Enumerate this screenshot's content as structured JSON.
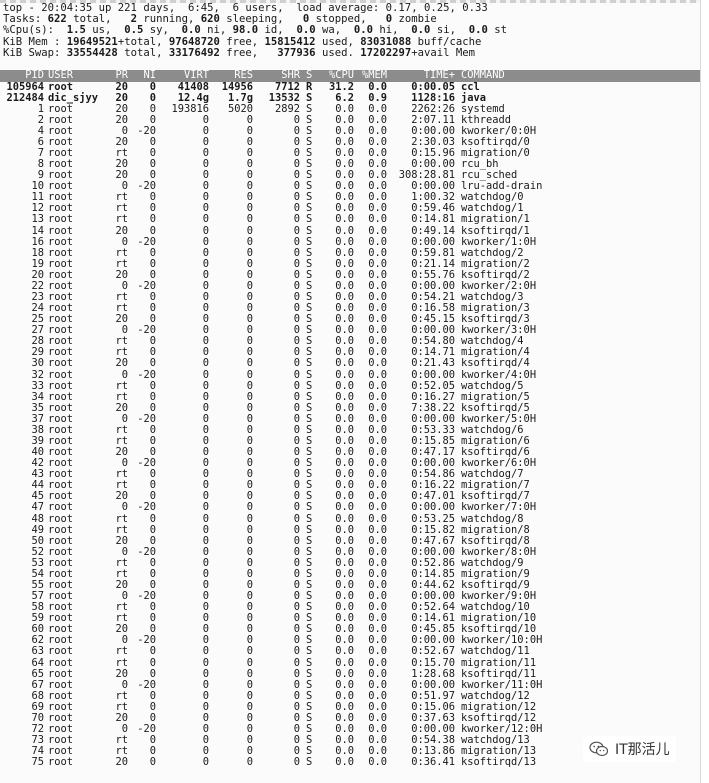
{
  "summary": {
    "line1": "top - 20:04:35 up 221 days,  6:45,  6 users,  load average: 0.17, 0.25, 0.33",
    "tasks_label": "Tasks:",
    "tasks": [
      {
        "value": "622",
        "label": " total,   "
      },
      {
        "value": "2",
        "label": " running, "
      },
      {
        "value": "620",
        "label": " sleeping,   "
      },
      {
        "value": "0",
        "label": " stopped,   "
      },
      {
        "value": "0",
        "label": " zombie"
      }
    ],
    "cpu_label": "%Cpu(s):",
    "cpu": [
      {
        "value": "  1.5",
        "label": " us,  "
      },
      {
        "value": "0.5",
        "label": " sy,  "
      },
      {
        "value": "0.0",
        "label": " ni, "
      },
      {
        "value": "98.0",
        "label": " id,  "
      },
      {
        "value": "0.0",
        "label": " wa,  "
      },
      {
        "value": "0.0",
        "label": " hi,  "
      },
      {
        "value": "0.0",
        "label": " si,  "
      },
      {
        "value": "0.0",
        "label": " st"
      }
    ],
    "mem_label": "KiB Mem :",
    "mem": [
      {
        "value": " 19649521",
        "label": "+total, "
      },
      {
        "value": "97648720",
        "label": " free, "
      },
      {
        "value": "15815412",
        "label": " used, "
      },
      {
        "value": "83031088",
        "label": " buff/cache"
      }
    ],
    "swap_label": "KiB Swap:",
    "swap": [
      {
        "value": " 33554428",
        "label": " total, "
      },
      {
        "value": "33176492",
        "label": " free,   "
      },
      {
        "value": "377936",
        "label": " used. "
      },
      {
        "value": "17202297",
        "label": "+avail Mem"
      }
    ]
  },
  "table": {
    "columns": [
      "PID",
      "USER",
      "PR",
      "NI",
      "VIRT",
      "RES",
      "SHR",
      "S",
      "%CPU",
      "%MEM",
      "TIME+",
      "COMMAND"
    ],
    "rows": [
      [
        "105964",
        "root",
        "20",
        "0",
        "41408",
        "14956",
        "7712",
        "R",
        "31.2",
        "0.0",
        "0:00.05",
        "ccl"
      ],
      [
        "212484",
        "dic_sjyy",
        "20",
        "0",
        "12.4g",
        "1.7g",
        "13532",
        "S",
        "6.2",
        "0.9",
        "1128:16",
        "java"
      ],
      [
        "1",
        "root",
        "20",
        "0",
        "193816",
        "5020",
        "2892",
        "S",
        "0.0",
        "0.0",
        "2262:26",
        "systemd"
      ],
      [
        "2",
        "root",
        "20",
        "0",
        "0",
        "0",
        "0",
        "S",
        "0.0",
        "0.0",
        "2:07.11",
        "kthreadd"
      ],
      [
        "4",
        "root",
        "0",
        "-20",
        "0",
        "0",
        "0",
        "S",
        "0.0",
        "0.0",
        "0:00.00",
        "kworker/0:0H"
      ],
      [
        "6",
        "root",
        "20",
        "0",
        "0",
        "0",
        "0",
        "S",
        "0.0",
        "0.0",
        "2:30.03",
        "ksoftirqd/0"
      ],
      [
        "7",
        "root",
        "rt",
        "0",
        "0",
        "0",
        "0",
        "S",
        "0.0",
        "0.0",
        "0:15.96",
        "migration/0"
      ],
      [
        "8",
        "root",
        "20",
        "0",
        "0",
        "0",
        "0",
        "S",
        "0.0",
        "0.0",
        "0:00.00",
        "rcu_bh"
      ],
      [
        "9",
        "root",
        "20",
        "0",
        "0",
        "0",
        "0",
        "S",
        "0.0",
        "0.0",
        "308:28.81",
        "rcu_sched"
      ],
      [
        "10",
        "root",
        "0",
        "-20",
        "0",
        "0",
        "0",
        "S",
        "0.0",
        "0.0",
        "0:00.00",
        "lru-add-drain"
      ],
      [
        "11",
        "root",
        "rt",
        "0",
        "0",
        "0",
        "0",
        "S",
        "0.0",
        "0.0",
        "1:00.32",
        "watchdog/0"
      ],
      [
        "12",
        "root",
        "rt",
        "0",
        "0",
        "0",
        "0",
        "S",
        "0.0",
        "0.0",
        "0:59.46",
        "watchdog/1"
      ],
      [
        "13",
        "root",
        "rt",
        "0",
        "0",
        "0",
        "0",
        "S",
        "0.0",
        "0.0",
        "0:14.81",
        "migration/1"
      ],
      [
        "14",
        "root",
        "20",
        "0",
        "0",
        "0",
        "0",
        "S",
        "0.0",
        "0.0",
        "0:49.14",
        "ksoftirqd/1"
      ],
      [
        "16",
        "root",
        "0",
        "-20",
        "0",
        "0",
        "0",
        "S",
        "0.0",
        "0.0",
        "0:00.00",
        "kworker/1:0H"
      ],
      [
        "18",
        "root",
        "rt",
        "0",
        "0",
        "0",
        "0",
        "S",
        "0.0",
        "0.0",
        "0:59.81",
        "watchdog/2"
      ],
      [
        "19",
        "root",
        "rt",
        "0",
        "0",
        "0",
        "0",
        "S",
        "0.0",
        "0.0",
        "0:21.14",
        "migration/2"
      ],
      [
        "20",
        "root",
        "20",
        "0",
        "0",
        "0",
        "0",
        "S",
        "0.0",
        "0.0",
        "0:55.76",
        "ksoftirqd/2"
      ],
      [
        "22",
        "root",
        "0",
        "-20",
        "0",
        "0",
        "0",
        "S",
        "0.0",
        "0.0",
        "0:00.00",
        "kworker/2:0H"
      ],
      [
        "23",
        "root",
        "rt",
        "0",
        "0",
        "0",
        "0",
        "S",
        "0.0",
        "0.0",
        "0:54.21",
        "watchdog/3"
      ],
      [
        "24",
        "root",
        "rt",
        "0",
        "0",
        "0",
        "0",
        "S",
        "0.0",
        "0.0",
        "0:16.58",
        "migration/3"
      ],
      [
        "25",
        "root",
        "20",
        "0",
        "0",
        "0",
        "0",
        "S",
        "0.0",
        "0.0",
        "0:45.15",
        "ksoftirqd/3"
      ],
      [
        "27",
        "root",
        "0",
        "-20",
        "0",
        "0",
        "0",
        "S",
        "0.0",
        "0.0",
        "0:00.00",
        "kworker/3:0H"
      ],
      [
        "28",
        "root",
        "rt",
        "0",
        "0",
        "0",
        "0",
        "S",
        "0.0",
        "0.0",
        "0:54.80",
        "watchdog/4"
      ],
      [
        "29",
        "root",
        "rt",
        "0",
        "0",
        "0",
        "0",
        "S",
        "0.0",
        "0.0",
        "0:14.71",
        "migration/4"
      ],
      [
        "30",
        "root",
        "20",
        "0",
        "0",
        "0",
        "0",
        "S",
        "0.0",
        "0.0",
        "0:21.43",
        "ksoftirqd/4"
      ],
      [
        "32",
        "root",
        "0",
        "-20",
        "0",
        "0",
        "0",
        "S",
        "0.0",
        "0.0",
        "0:00.00",
        "kworker/4:0H"
      ],
      [
        "33",
        "root",
        "rt",
        "0",
        "0",
        "0",
        "0",
        "S",
        "0.0",
        "0.0",
        "0:52.05",
        "watchdog/5"
      ],
      [
        "34",
        "root",
        "rt",
        "0",
        "0",
        "0",
        "0",
        "S",
        "0.0",
        "0.0",
        "0:16.27",
        "migration/5"
      ],
      [
        "35",
        "root",
        "20",
        "0",
        "0",
        "0",
        "0",
        "S",
        "0.0",
        "0.0",
        "7:38.22",
        "ksoftirqd/5"
      ],
      [
        "37",
        "root",
        "0",
        "-20",
        "0",
        "0",
        "0",
        "S",
        "0.0",
        "0.0",
        "0:00.00",
        "kworker/5:0H"
      ],
      [
        "38",
        "root",
        "rt",
        "0",
        "0",
        "0",
        "0",
        "S",
        "0.0",
        "0.0",
        "0:53.33",
        "watchdog/6"
      ],
      [
        "39",
        "root",
        "rt",
        "0",
        "0",
        "0",
        "0",
        "S",
        "0.0",
        "0.0",
        "0:15.85",
        "migration/6"
      ],
      [
        "40",
        "root",
        "20",
        "0",
        "0",
        "0",
        "0",
        "S",
        "0.0",
        "0.0",
        "0:47.17",
        "ksoftirqd/6"
      ],
      [
        "42",
        "root",
        "0",
        "-20",
        "0",
        "0",
        "0",
        "S",
        "0.0",
        "0.0",
        "0:00.00",
        "kworker/6:0H"
      ],
      [
        "43",
        "root",
        "rt",
        "0",
        "0",
        "0",
        "0",
        "S",
        "0.0",
        "0.0",
        "0:54.86",
        "watchdog/7"
      ],
      [
        "44",
        "root",
        "rt",
        "0",
        "0",
        "0",
        "0",
        "S",
        "0.0",
        "0.0",
        "0:16.22",
        "migration/7"
      ],
      [
        "45",
        "root",
        "20",
        "0",
        "0",
        "0",
        "0",
        "S",
        "0.0",
        "0.0",
        "0:47.01",
        "ksoftirqd/7"
      ],
      [
        "47",
        "root",
        "0",
        "-20",
        "0",
        "0",
        "0",
        "S",
        "0.0",
        "0.0",
        "0:00.00",
        "kworker/7:0H"
      ],
      [
        "48",
        "root",
        "rt",
        "0",
        "0",
        "0",
        "0",
        "S",
        "0.0",
        "0.0",
        "0:53.25",
        "watchdog/8"
      ],
      [
        "49",
        "root",
        "rt",
        "0",
        "0",
        "0",
        "0",
        "S",
        "0.0",
        "0.0",
        "0:15.82",
        "migration/8"
      ],
      [
        "50",
        "root",
        "20",
        "0",
        "0",
        "0",
        "0",
        "S",
        "0.0",
        "0.0",
        "0:47.67",
        "ksoftirqd/8"
      ],
      [
        "52",
        "root",
        "0",
        "-20",
        "0",
        "0",
        "0",
        "S",
        "0.0",
        "0.0",
        "0:00.00",
        "kworker/8:0H"
      ],
      [
        "53",
        "root",
        "rt",
        "0",
        "0",
        "0",
        "0",
        "S",
        "0.0",
        "0.0",
        "0:52.86",
        "watchdog/9"
      ],
      [
        "54",
        "root",
        "rt",
        "0",
        "0",
        "0",
        "0",
        "S",
        "0.0",
        "0.0",
        "0:14.85",
        "migration/9"
      ],
      [
        "55",
        "root",
        "20",
        "0",
        "0",
        "0",
        "0",
        "S",
        "0.0",
        "0.0",
        "0:44.62",
        "ksoftirqd/9"
      ],
      [
        "57",
        "root",
        "0",
        "-20",
        "0",
        "0",
        "0",
        "S",
        "0.0",
        "0.0",
        "0:00.00",
        "kworker/9:0H"
      ],
      [
        "58",
        "root",
        "rt",
        "0",
        "0",
        "0",
        "0",
        "S",
        "0.0",
        "0.0",
        "0:52.64",
        "watchdog/10"
      ],
      [
        "59",
        "root",
        "rt",
        "0",
        "0",
        "0",
        "0",
        "S",
        "0.0",
        "0.0",
        "0:14.61",
        "migration/10"
      ],
      [
        "60",
        "root",
        "20",
        "0",
        "0",
        "0",
        "0",
        "S",
        "0.0",
        "0.0",
        "0:45.85",
        "ksoftirqd/10"
      ],
      [
        "62",
        "root",
        "0",
        "-20",
        "0",
        "0",
        "0",
        "S",
        "0.0",
        "0.0",
        "0:00.00",
        "kworker/10:0H"
      ],
      [
        "63",
        "root",
        "rt",
        "0",
        "0",
        "0",
        "0",
        "S",
        "0.0",
        "0.0",
        "0:52.67",
        "watchdog/11"
      ],
      [
        "64",
        "root",
        "rt",
        "0",
        "0",
        "0",
        "0",
        "S",
        "0.0",
        "0.0",
        "0:15.70",
        "migration/11"
      ],
      [
        "65",
        "root",
        "20",
        "0",
        "0",
        "0",
        "0",
        "S",
        "0.0",
        "0.0",
        "1:28.68",
        "ksoftirqd/11"
      ],
      [
        "67",
        "root",
        "0",
        "-20",
        "0",
        "0",
        "0",
        "S",
        "0.0",
        "0.0",
        "0:00.00",
        "kworker/11:0H"
      ],
      [
        "68",
        "root",
        "rt",
        "0",
        "0",
        "0",
        "0",
        "S",
        "0.0",
        "0.0",
        "0:51.97",
        "watchdog/12"
      ],
      [
        "69",
        "root",
        "rt",
        "0",
        "0",
        "0",
        "0",
        "S",
        "0.0",
        "0.0",
        "0:15.06",
        "migration/12"
      ],
      [
        "70",
        "root",
        "20",
        "0",
        "0",
        "0",
        "0",
        "S",
        "0.0",
        "0.0",
        "0:37.63",
        "ksoftirqd/12"
      ],
      [
        "72",
        "root",
        "0",
        "-20",
        "0",
        "0",
        "0",
        "S",
        "0.0",
        "0.0",
        "0:00.00",
        "kworker/12:0H"
      ],
      [
        "73",
        "root",
        "rt",
        "0",
        "0",
        "0",
        "0",
        "S",
        "0.0",
        "0.0",
        "0:54.38",
        "watchdog/13"
      ],
      [
        "74",
        "root",
        "rt",
        "0",
        "0",
        "0",
        "0",
        "S",
        "0.0",
        "0.0",
        "0:13.86",
        "migration/13"
      ],
      [
        "75",
        "root",
        "20",
        "0",
        "0",
        "0",
        "0",
        "S",
        "0.0",
        "0.0",
        "0:36.41",
        "ksoftirqd/13"
      ]
    ],
    "bold_rows": 2
  },
  "watermark": {
    "text": "IT那活儿",
    "icon": "wechat-icon"
  },
  "colors": {
    "header_bg": "#8c8c8c",
    "header_fg": "#ffffff",
    "background": "#fbfbfb"
  }
}
